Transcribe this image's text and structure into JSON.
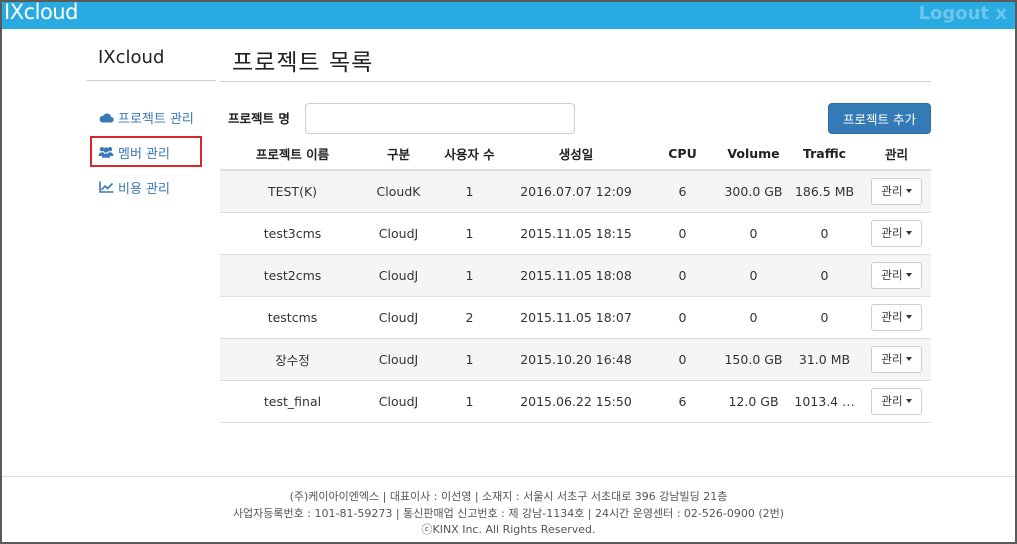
{
  "app": {
    "brand": "IXcloud",
    "logout_label": "Logout",
    "logout_icon": "x"
  },
  "sidebar": {
    "title": "IXcloud",
    "items": [
      {
        "label": "프로젝트 관리",
        "icon": "cloud-icon"
      },
      {
        "label": "멤버 관리",
        "icon": "users-icon"
      },
      {
        "label": "비용 관리",
        "icon": "line-chart-icon"
      }
    ]
  },
  "main": {
    "title": "프로젝트 목록",
    "search": {
      "label": "프로젝트 명",
      "value": "",
      "placeholder": ""
    },
    "add_button": "프로젝트 추가",
    "table": {
      "headers": [
        "프로젝트 이름",
        "구분",
        "사용자 수",
        "생성일",
        "CPU",
        "Volume",
        "Traffic",
        "관리"
      ],
      "manage_label": "관리",
      "rows": [
        {
          "name": "TEST(K)",
          "type": "CloudK",
          "users": "1",
          "created": "2016.07.07 12:09",
          "cpu": "6",
          "volume": "300.0 GB",
          "traffic": "186.5 MB"
        },
        {
          "name": "test3cms",
          "type": "CloudJ",
          "users": "1",
          "created": "2015.11.05 18:15",
          "cpu": "0",
          "volume": "0",
          "traffic": "0"
        },
        {
          "name": "test2cms",
          "type": "CloudJ",
          "users": "1",
          "created": "2015.11.05 18:08",
          "cpu": "0",
          "volume": "0",
          "traffic": "0"
        },
        {
          "name": "testcms",
          "type": "CloudJ",
          "users": "2",
          "created": "2015.11.05 18:07",
          "cpu": "0",
          "volume": "0",
          "traffic": "0"
        },
        {
          "name": "장수정",
          "type": "CloudJ",
          "users": "1",
          "created": "2015.10.20 16:48",
          "cpu": "0",
          "volume": "150.0 GB",
          "traffic": "31.0 MB"
        },
        {
          "name": "test_final",
          "type": "CloudJ",
          "users": "1",
          "created": "2015.06.22 15:50",
          "cpu": "6",
          "volume": "12.0 GB",
          "traffic": "1013.4 …"
        }
      ]
    }
  },
  "footer": {
    "line1": "(주)케이아이엔엑스 | 대표이사 : 이선영 | 소재지 : 서울시 서초구 서초대로 396 강남빌딩 21층",
    "line2": "사업자등록번호 : 101-81-59273 | 통신판매업 신고번호 : 제 강남-1134호 | 24시간 운영센터 : 02-526-0900 (2번)",
    "line3": "ⓒKINX Inc. All Rights Reserved."
  },
  "colors": {
    "topbar": "#29abe2",
    "primary": "#337ab7",
    "link": "#3b78b8",
    "highlight": "#d9262c"
  }
}
